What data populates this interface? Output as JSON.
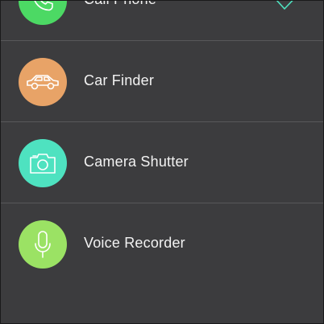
{
  "items": [
    {
      "label": "Call Phone",
      "icon": "phone-icon",
      "color": "#4cd964",
      "selected": true
    },
    {
      "label": "Car Finder",
      "icon": "car-icon",
      "color": "#e8a367",
      "selected": false
    },
    {
      "label": "Camera Shutter",
      "icon": "camera-icon",
      "color": "#4ee2c0",
      "selected": false
    },
    {
      "label": "Voice Recorder",
      "icon": "microphone-icon",
      "color": "#9be264",
      "selected": false
    }
  ],
  "colors": {
    "background": "#3c3c3e",
    "divider": "#58585a",
    "checkmark": "#4ee2c0",
    "text": "#f2f2f2"
  }
}
